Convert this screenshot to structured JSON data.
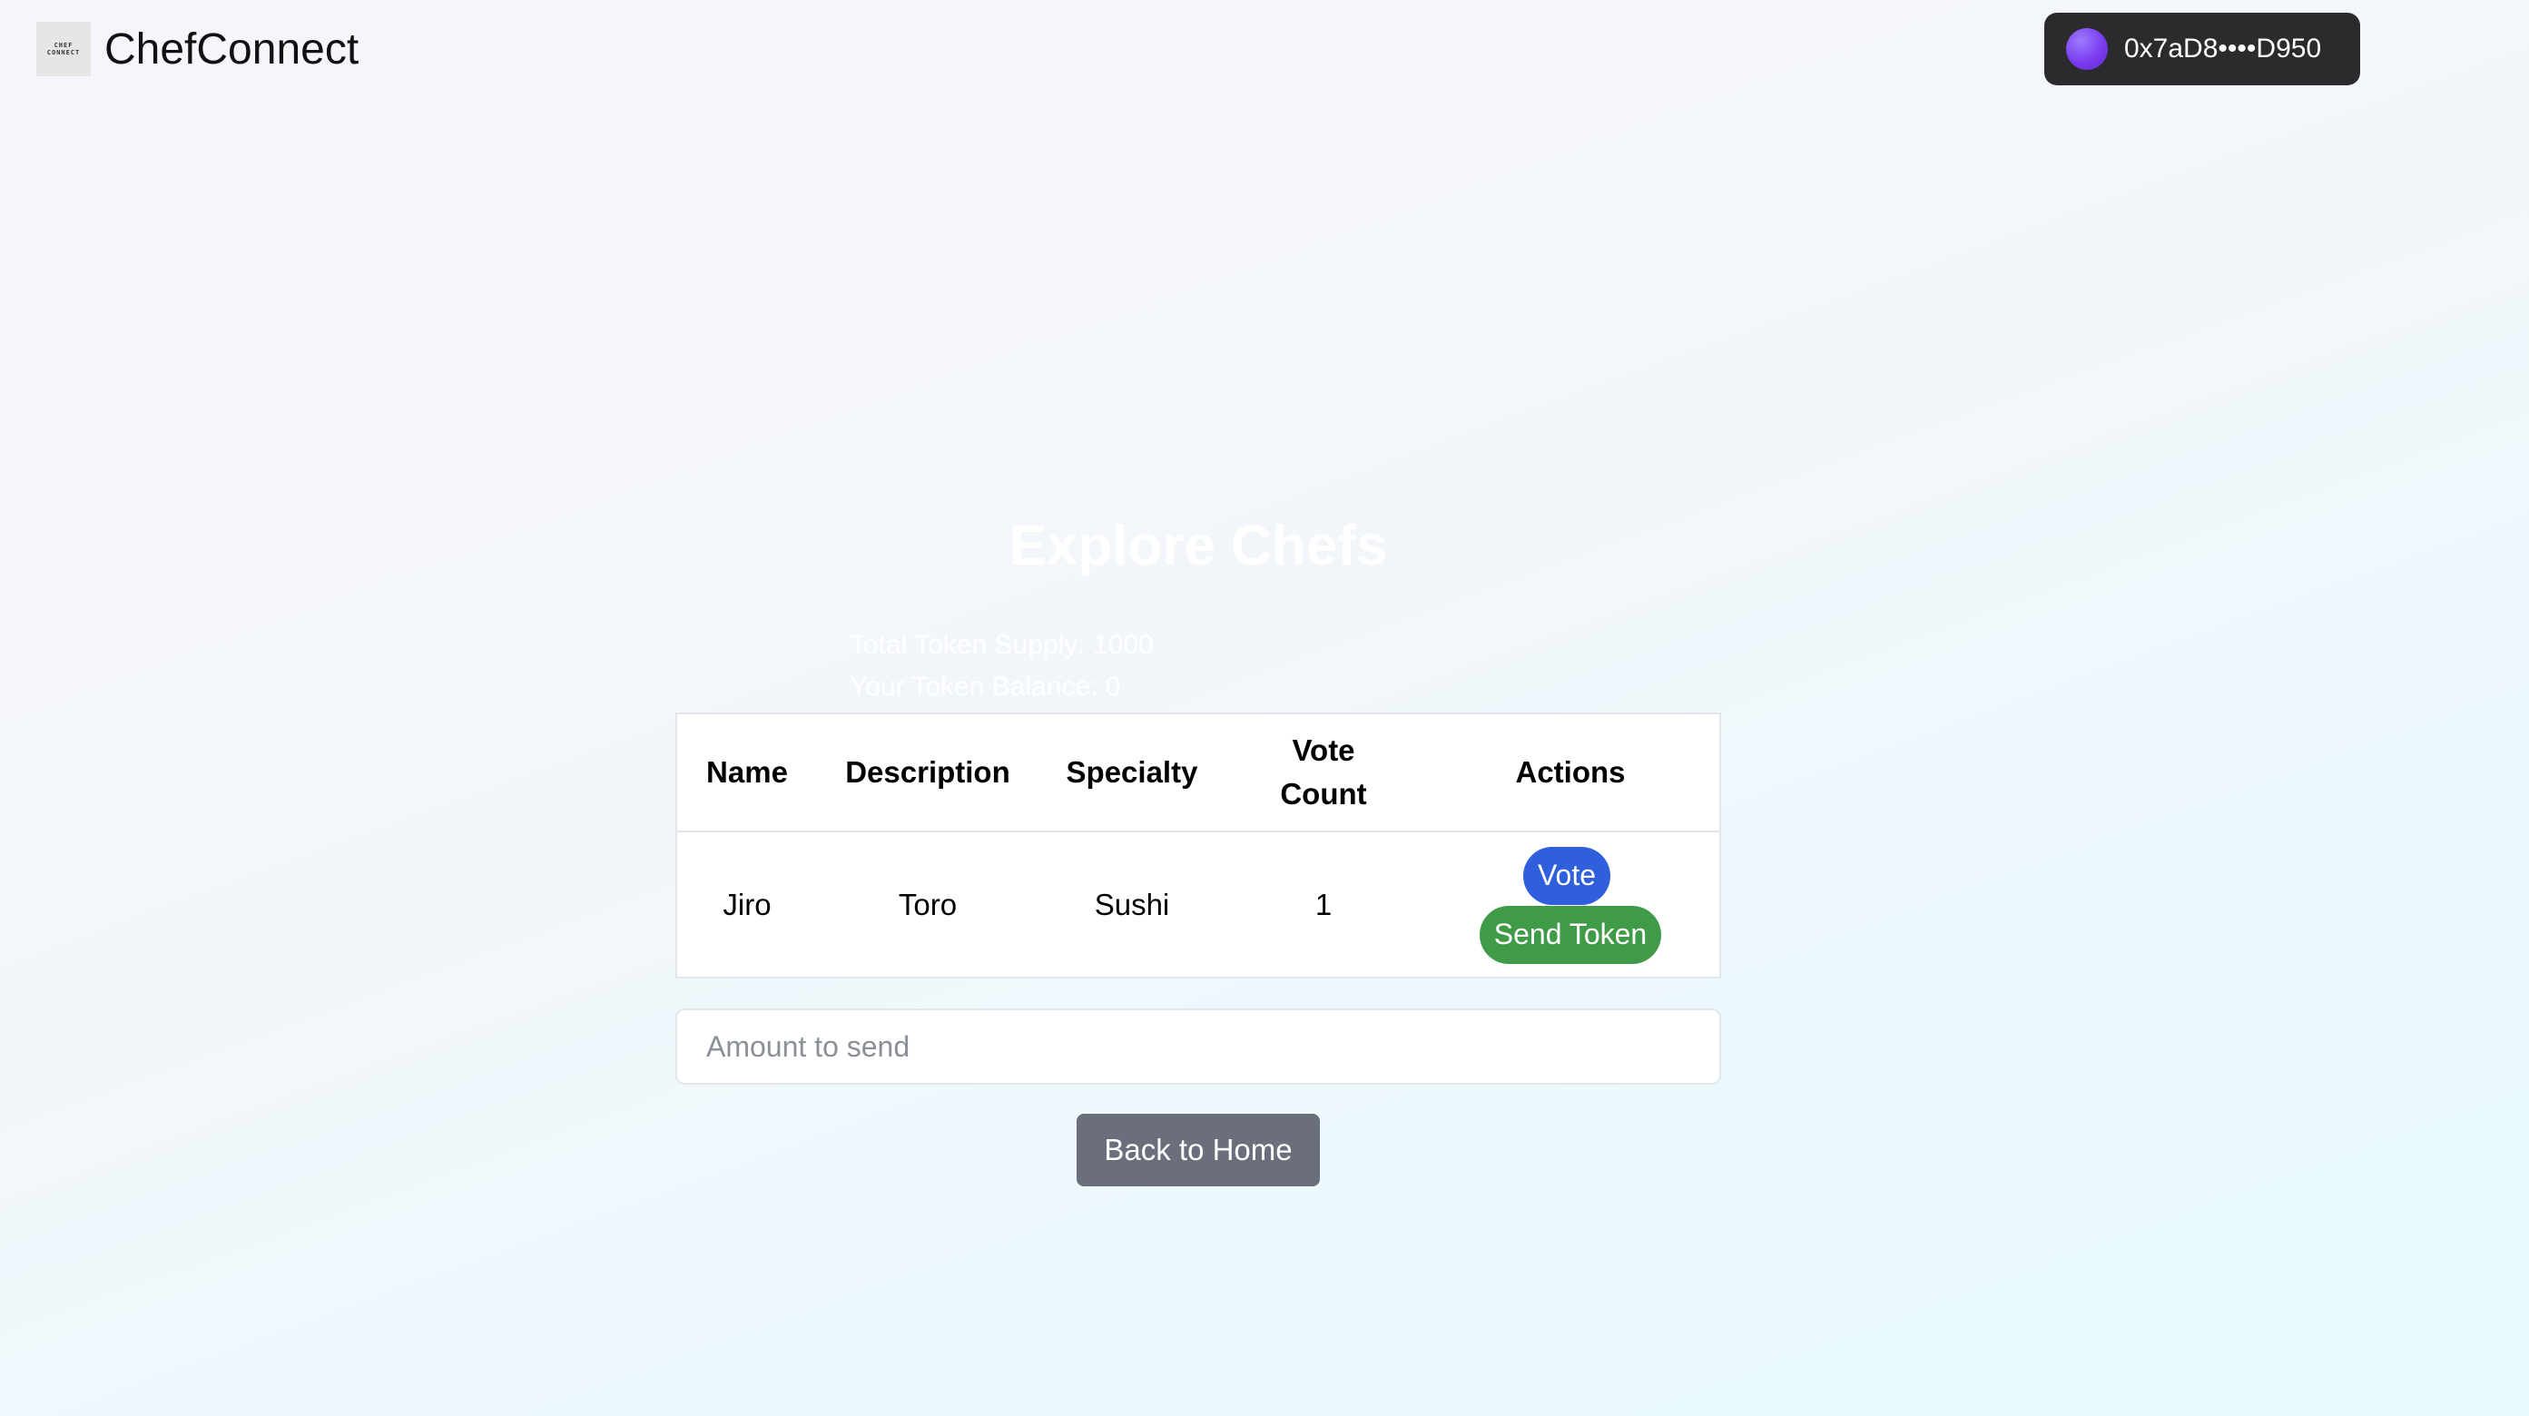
{
  "navbar": {
    "logo_line1": "CHEF",
    "logo_line2": "CONNECT",
    "brand": "ChefConnect",
    "wallet_address": "0x7aD8••••D950"
  },
  "main": {
    "title": "Explore Chefs",
    "total_token_supply": "Total Token Supply: 1000",
    "your_token_balance": "Your Token Balance: 0"
  },
  "table": {
    "headers": [
      "Name",
      "Description",
      "Specialty",
      "Vote Count",
      "Actions"
    ],
    "rows": [
      {
        "name": "Jiro",
        "description": "Toro",
        "specialty": "Sushi",
        "vote_count": "1",
        "vote_label": "Vote",
        "send_label": "Send Token"
      }
    ]
  },
  "amount_input": {
    "value": "",
    "placeholder": "Amount to send"
  },
  "back_button": "Back to Home",
  "colors": {
    "vote_button": "#2f5fdc",
    "send_button": "#3f9b47",
    "back_button": "#6a6f7b",
    "wallet_bg": "#2b2b2e"
  }
}
